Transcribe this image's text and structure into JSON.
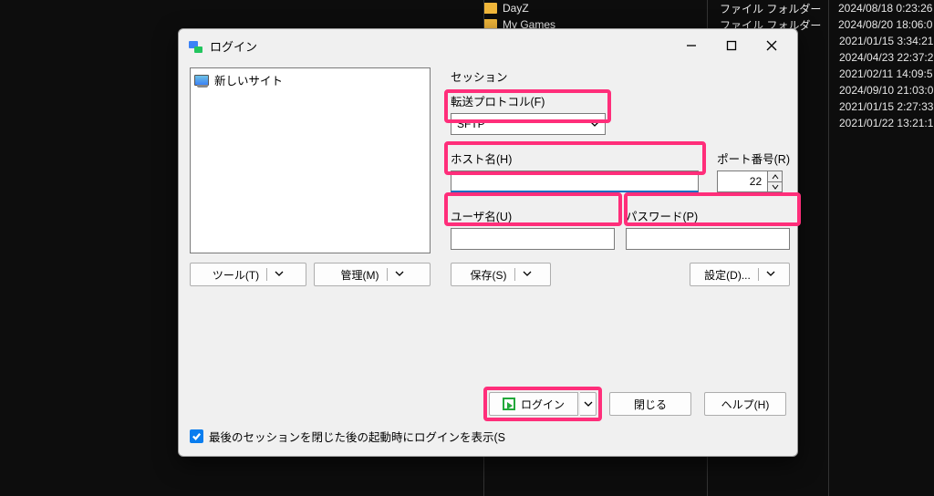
{
  "background": {
    "files": [
      {
        "name": "DayZ",
        "type": "ファイル フォルダー",
        "date": "2024/08/18 0:23:26"
      },
      {
        "name": "My Games",
        "type": "ファイル フォルダー",
        "date": "2024/08/20 18:06:0"
      }
    ],
    "extra_dates": [
      "2021/01/15 3:34:21",
      "2024/04/23 22:37:2",
      "2021/02/11 14:09:5",
      "2024/09/10 21:03:0",
      "2021/01/15 2:27:33",
      "2021/01/22 13:21:1"
    ]
  },
  "dialog": {
    "title": "ログイン",
    "sites_header_item": "新しいサイト",
    "session": {
      "section_label": "セッション",
      "protocol_label": "転送プロトコル(F)",
      "protocol_value": "SFTP",
      "host_label": "ホスト名(H)",
      "host_value": "",
      "port_label": "ポート番号(R)",
      "port_value": "22",
      "user_label": "ユーザ名(U)",
      "user_value": "",
      "password_label": "パスワード(P)",
      "password_value": ""
    },
    "buttons": {
      "tool": "ツール(T)",
      "manage": "管理(M)",
      "save": "保存(S)",
      "settings": "設定(D)...",
      "login": "ログイン",
      "close": "閉じる",
      "help": "ヘルプ(H)"
    },
    "checkbox_label": "最後のセッションを閉じた後の起動時にログインを表示(S",
    "checkbox_checked": true
  }
}
